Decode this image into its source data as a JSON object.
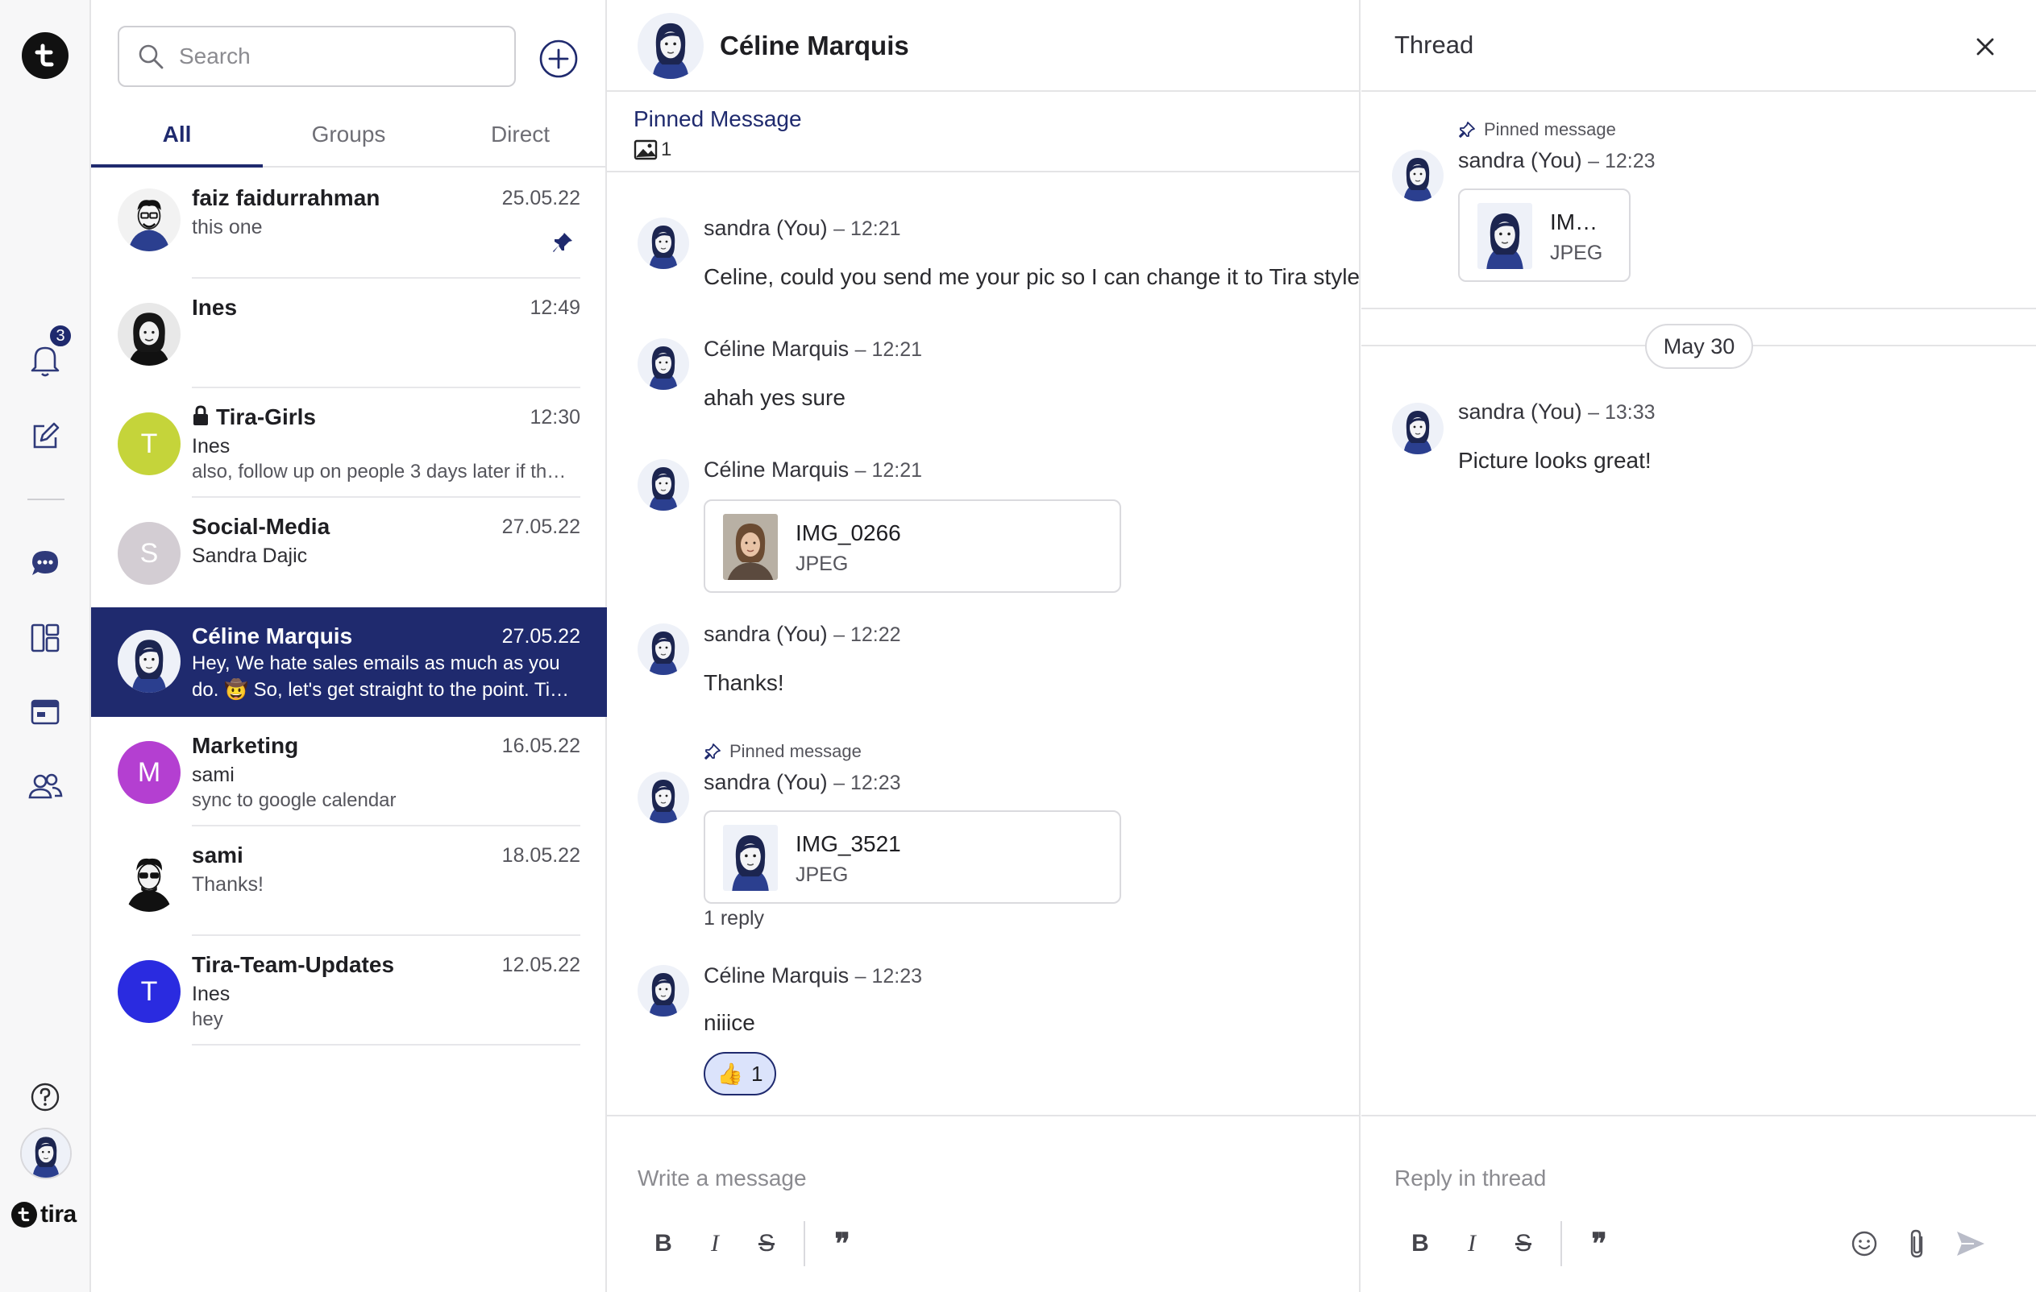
{
  "search": {
    "placeholder": "Search"
  },
  "tabs": [
    {
      "label": "All",
      "active": true
    },
    {
      "label": "Groups",
      "active": false
    },
    {
      "label": "Direct",
      "active": false
    }
  ],
  "rail": {
    "notification_count": "3",
    "brand": "tira"
  },
  "conversations": [
    {
      "name": "faiz faidurrahman",
      "date": "25.05.22",
      "preview": "this one",
      "pinned": true
    },
    {
      "name": "Ines",
      "date": "12:49"
    },
    {
      "name": "Tira-Girls",
      "date": "12:30",
      "sender": "Ines",
      "preview": "also, follow up on people 3 days later if th…",
      "locked": true,
      "avatar_letter": "T",
      "avatar_color": "#c5d43a"
    },
    {
      "name": "Social-Media",
      "date": "27.05.22",
      "sender": "Sandra Dajic",
      "avatar_letter": "S",
      "avatar_color": "#d3cdd3"
    },
    {
      "name": "Céline Marquis",
      "date": "27.05.22",
      "preview_line1": "Hey, We hate sales emails as much as you",
      "preview_line2": "do. 🤠 So, let's get straight to the point. Ti…",
      "selected": true
    },
    {
      "name": "Marketing",
      "date": "16.05.22",
      "sender": "sami",
      "preview": "sync to google calendar",
      "avatar_letter": "M",
      "avatar_color": "#b43fd1"
    },
    {
      "name": "sami",
      "date": "18.05.22",
      "preview": "Thanks!"
    },
    {
      "name": "Tira-Team-Updates",
      "date": "12.05.22",
      "sender": "Ines",
      "preview": "hey",
      "avatar_letter": "T",
      "avatar_color": "#2a2be0"
    }
  ],
  "main": {
    "contact_name": "Céline Marquis",
    "pinned_title": "Pinned Message",
    "pinned_count": "1",
    "messages": [
      {
        "author": "sandra (You)",
        "time": "– 12:21",
        "text": "Celine, could you send me your pic so I can change it to Tira style"
      },
      {
        "author": "Céline Marquis",
        "time": "– 12:21",
        "text": "ahah yes sure"
      },
      {
        "author": "Céline Marquis",
        "time": "– 12:21",
        "file_name": "IMG_0266",
        "file_type": "JPEG"
      },
      {
        "author": "sandra (You)",
        "time": "– 12:22",
        "text": "Thanks!"
      },
      {
        "pin_label": "Pinned message",
        "author": "sandra (You)",
        "time": "– 12:23",
        "file_name": "IMG_3521",
        "file_type": "JPEG",
        "replies": "1 reply"
      },
      {
        "author": "Céline Marquis",
        "time": "– 12:23",
        "text": "niiice",
        "reaction_emoji": "👍",
        "reaction_count": "1"
      }
    ],
    "composer_placeholder": "Write a message"
  },
  "thread": {
    "title": "Thread",
    "pin_label": "Pinned message",
    "root_author": "sandra (You)",
    "root_time": "– 12:23",
    "root_file_name": "IM…",
    "root_file_type": "JPEG",
    "date_divider": "May 30",
    "reply_author": "sandra (You)",
    "reply_time": "– 13:33",
    "reply_text": "Picture looks great!",
    "composer_placeholder": "Reply in thread"
  },
  "colors": {
    "accent": "#1f2a6e",
    "reaction_bg": "#dbe3fb"
  },
  "icons": [
    "search-icon",
    "add-icon",
    "bell-icon",
    "edit-icon",
    "chat-icon",
    "board-icon",
    "calendar-icon",
    "people-icon",
    "help-icon",
    "pin-icon",
    "lock-icon",
    "image-icon",
    "close-icon",
    "bold-icon",
    "italic-icon",
    "strikethrough-icon",
    "quote-icon",
    "emoji-icon",
    "attach-icon",
    "send-icon"
  ]
}
